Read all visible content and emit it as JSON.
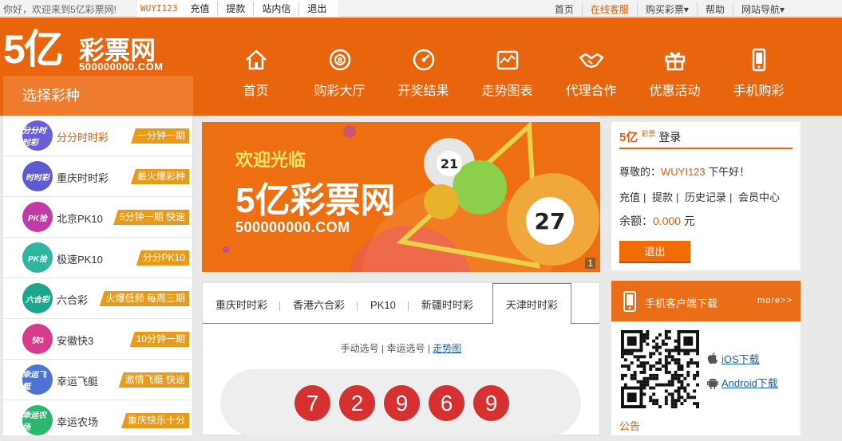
{
  "topbar": {
    "welcome": "你好，欢迎来到5亿彩票网!",
    "username": "WUYI123",
    "links": [
      "充值",
      "提款",
      "站内信",
      "退出"
    ],
    "right": [
      "首页",
      "在线客服",
      "购买彩票▾",
      "帮助",
      "网站导航▾"
    ]
  },
  "logo": {
    "big": "5亿",
    "cn": "彩票网",
    "url": "500000000.COM"
  },
  "nav": [
    "首页",
    "购彩大厅",
    "开奖结果",
    "走势图表",
    "代理合作",
    "优惠活动",
    "手机购彩"
  ],
  "nav_icons": [
    "house-icon",
    "lottery-ball-icon",
    "draw-result-icon",
    "trend-chart-icon",
    "handshake-icon",
    "gift-icon",
    "mobile-phone-icon"
  ],
  "choose_title": "选择彩种",
  "lotteries": [
    {
      "name": "分分时时彩",
      "tag": "一分钟一期",
      "badge": "分分时时彩",
      "color": "#6a5fd8"
    },
    {
      "name": "重庆时时彩",
      "tag": "最火爆彩种",
      "badge": "时时彩",
      "color": "#5f5ad4"
    },
    {
      "name": "北京PK10",
      "tag": "5分钟一期 快速",
      "badge": "PK拾",
      "color": "#c13aa5"
    },
    {
      "name": "极速PK10",
      "tag": "分分PK10",
      "badge": "PK拾",
      "color": "#2fb5a0"
    },
    {
      "name": "六合彩",
      "tag": "火爆低频 每周三期",
      "badge": "六合彩",
      "color": "#1ca78c"
    },
    {
      "name": "安徽快3",
      "tag": "10分钟一期",
      "badge": "快3",
      "color": "#d83a8c"
    },
    {
      "name": "幸运飞艇",
      "tag": "激情飞艇 快速",
      "badge": "幸运飞艇",
      "color": "#4d73d4"
    },
    {
      "name": "幸运农场",
      "tag": "重庆快乐十分",
      "badge": "幸运农场",
      "color": "#2ab86c"
    }
  ],
  "banner": {
    "line1": "欢迎光临",
    "line2": "5亿彩票网",
    "line3": "500000000.COM",
    "page": "1",
    "balls": [
      "21",
      "27"
    ]
  },
  "login": {
    "mini_logo": "5亿",
    "mini_tag": "彩票",
    "title": "登录",
    "greet_prefix": "尊敬的：",
    "greet_user": "WUYI123",
    "greet_suffix": " 下午好！",
    "links": [
      "充值",
      "提款",
      "历史记录",
      "会员中心"
    ],
    "balance_label": "余额：",
    "balance_value": "0.000",
    "balance_unit": " 元",
    "logout": "退出"
  },
  "draw": {
    "tabs": [
      "重庆时时彩",
      "香港六合彩",
      "PK10",
      "新疆时时彩",
      "天津时时彩"
    ],
    "active_tab": 4,
    "opt1": "手动选号",
    "opt2": "幸运选号",
    "opt3": "走势图",
    "numbers": [
      "7",
      "2",
      "9",
      "6",
      "9"
    ]
  },
  "download": {
    "title": "手机客户端下载",
    "more": "more>>",
    "ios": "iOS下载",
    "android": "Android下载",
    "notice": "公告"
  },
  "colors": {
    "brand": "#e8650e",
    "accent": "#e65c00",
    "ball": "#d63030",
    "link": "#1a64b0"
  }
}
